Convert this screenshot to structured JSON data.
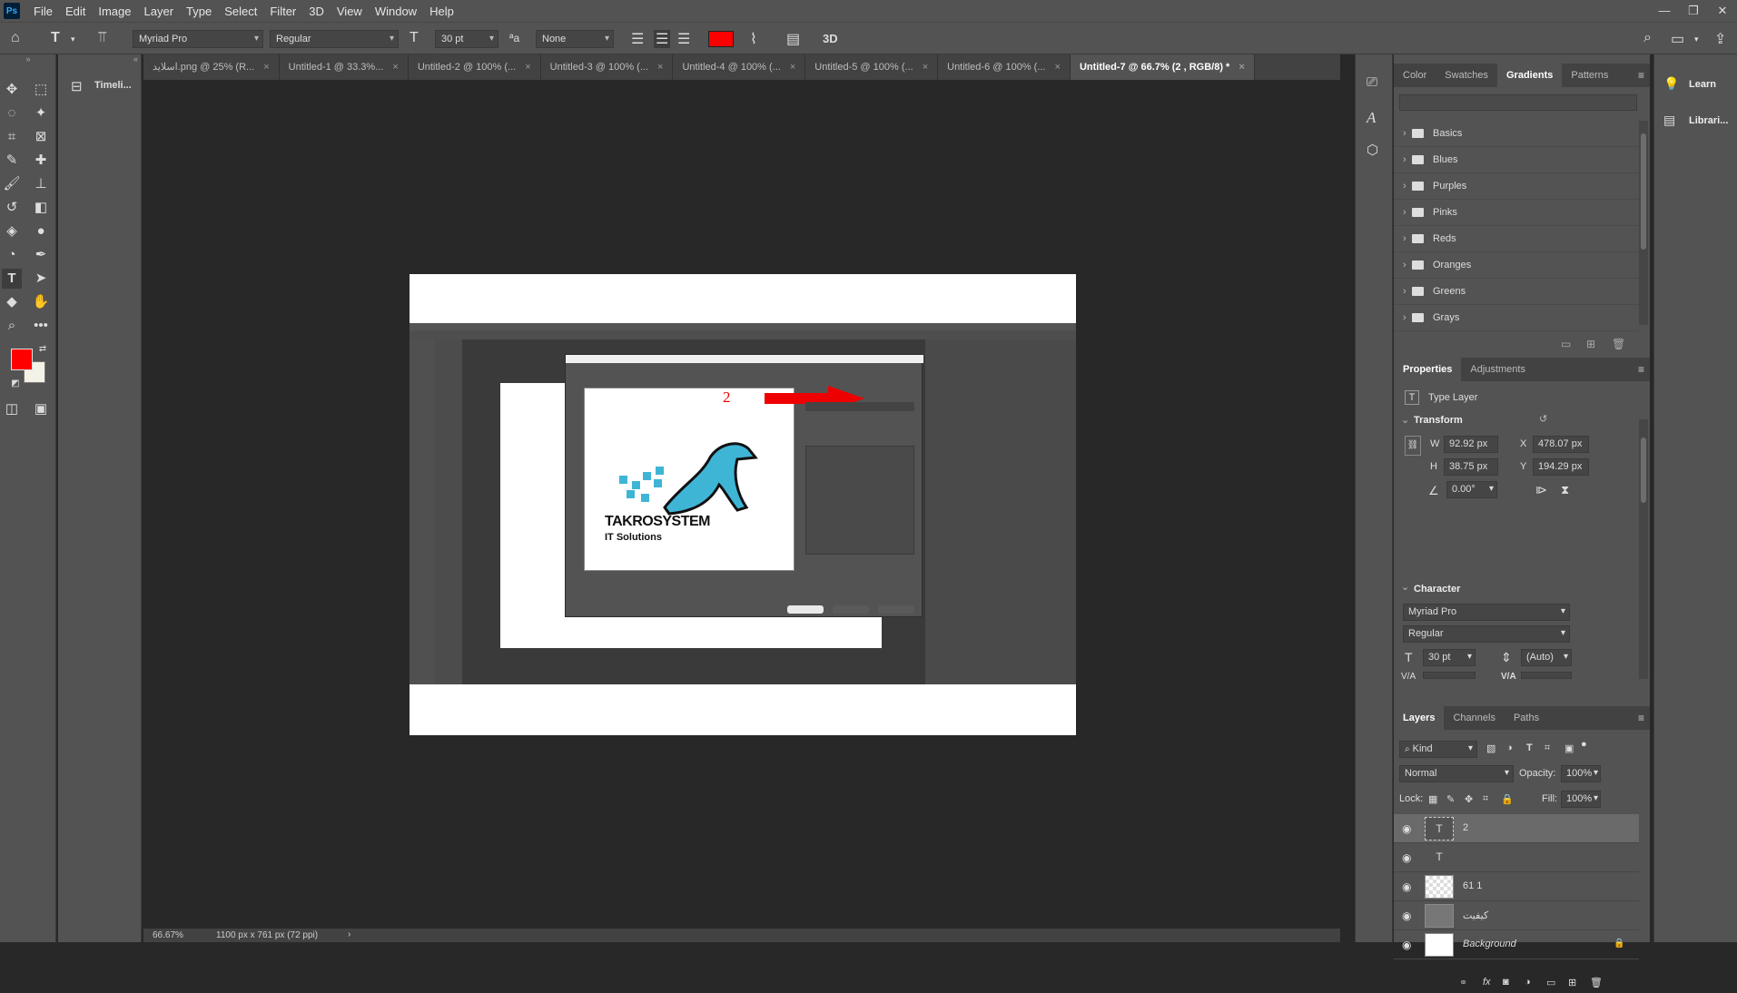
{
  "app": {
    "logo": "Ps"
  },
  "menu": [
    "File",
    "Edit",
    "Image",
    "Layer",
    "Type",
    "Select",
    "Filter",
    "3D",
    "View",
    "Window",
    "Help"
  ],
  "options": {
    "font_family": "Myriad Pro",
    "font_style": "Regular",
    "font_size": "30 pt",
    "aa_label": "ªa",
    "antialias": "None",
    "text_color": "#ff0000",
    "three_d": "3D"
  },
  "mini_panel": {
    "timeline_label": "Timeli..."
  },
  "tabs": [
    {
      "label": "اسلاید.png @ 25% (R...",
      "close": "×"
    },
    {
      "label": "Untitled-1 @ 33.3%...",
      "close": "×"
    },
    {
      "label": "Untitled-2 @ 100% (...",
      "close": "×"
    },
    {
      "label": "Untitled-3 @ 100% (...",
      "close": "×"
    },
    {
      "label": "Untitled-4 @ 100% (...",
      "close": "×"
    },
    {
      "label": "Untitled-5 @ 100% (...",
      "close": "×"
    },
    {
      "label": "Untitled-6 @ 100% (...",
      "close": "×"
    },
    {
      "label": "Untitled-7 @ 66.7% (2  , RGB/8) *",
      "close": "×"
    }
  ],
  "canvas": {
    "annotation_number": "2",
    "logo_text_1": "TAKROSYSTEM",
    "logo_text_2": "IT Solutions"
  },
  "status": {
    "zoom": "66.67%",
    "doc_info": "1100 px x 761 px (72 ppi)"
  },
  "gradients_panel": {
    "tabs": [
      "Color",
      "Swatches",
      "Gradients",
      "Patterns"
    ],
    "active_tab": "Gradients",
    "folders": [
      "Basics",
      "Blues",
      "Purples",
      "Pinks",
      "Reds",
      "Oranges",
      "Greens",
      "Grays"
    ]
  },
  "properties_panel": {
    "tabs": [
      "Properties",
      "Adjustments"
    ],
    "layer_type": "Type Layer",
    "transform_title": "Transform",
    "w_label": "W",
    "w": "92.92 px",
    "h_label": "H",
    "h": "38.75 px",
    "x_label": "X",
    "x": "478.07 px",
    "y_label": "Y",
    "y": "194.29 px",
    "angle": "0.00°",
    "character_title": "Character",
    "font": "Myriad Pro",
    "style": "Regular",
    "size": "30 pt",
    "leading": "(Auto)",
    "tracking_label": "V/A"
  },
  "layers_panel": {
    "tabs": [
      "Layers",
      "Channels",
      "Paths"
    ],
    "kind": "Kind",
    "blend": "Normal",
    "opacity_label": "Opacity:",
    "opacity": "100%",
    "lock_label": "Lock:",
    "fill_label": "Fill:",
    "fill": "100%",
    "layers": [
      {
        "name": "2",
        "type": "text",
        "selected": true
      },
      {
        "name": "",
        "type": "text",
        "selected": false
      },
      {
        "name": "61 1",
        "type": "image",
        "selected": false
      },
      {
        "name": "کیفیت",
        "type": "image",
        "selected": false
      },
      {
        "name": "Background",
        "type": "background",
        "selected": false
      }
    ]
  },
  "learn_panel": {
    "learn": "Learn",
    "libraries": "Librari..."
  },
  "colors": {
    "foreground": "#ff0000",
    "background": "#f4f1e6",
    "accent": "#ff0000"
  }
}
